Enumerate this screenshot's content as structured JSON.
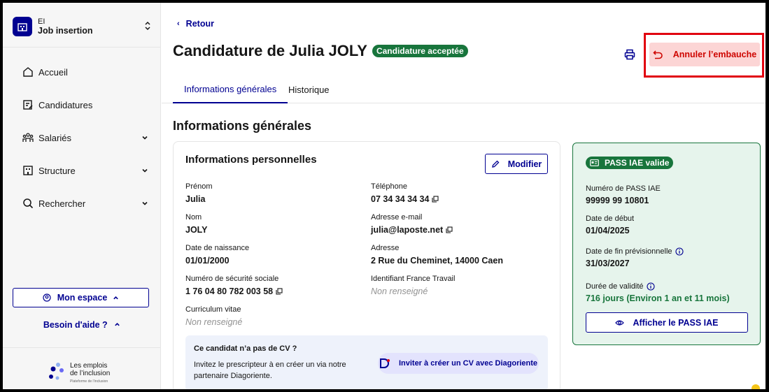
{
  "sidebar": {
    "org_kind": "EI",
    "org_name": "Job insertion",
    "nav": [
      {
        "label": "Accueil",
        "icon": "home-icon"
      },
      {
        "label": "Candidatures",
        "icon": "edit-list-icon"
      },
      {
        "label": "Salariés",
        "icon": "people-icon"
      },
      {
        "label": "Structure",
        "icon": "building-icon"
      },
      {
        "label": "Rechercher",
        "icon": "search-icon"
      }
    ],
    "mon_espace": "Mon espace",
    "help": "Besoin d'aide ?",
    "brand_line1": "Les emplois",
    "brand_line2": "de l’inclusion",
    "brand_sub": "Plateforme de l’inclusion"
  },
  "header": {
    "back": "Retour",
    "title": "Candidature de Julia JOLY",
    "status_badge": "Candidature acceptée",
    "cancel_button": "Annuler l’embauche"
  },
  "tabs": [
    {
      "label": "Informations générales",
      "active": true
    },
    {
      "label": "Historique",
      "active": false
    }
  ],
  "section_title": "Informations générales",
  "personal": {
    "title": "Informations personnelles",
    "edit_button": "Modifier",
    "fields": {
      "prenom": {
        "label": "Prénom",
        "value": "Julia"
      },
      "telephone": {
        "label": "Téléphone",
        "value": "07 34 34 34 34"
      },
      "nom": {
        "label": "Nom",
        "value": "JOLY"
      },
      "email": {
        "label": "Adresse e-mail",
        "value": "julia@laposte.net"
      },
      "naissance": {
        "label": "Date de naissance",
        "value": "01/01/2000"
      },
      "adresse": {
        "label": "Adresse",
        "value": "2 Rue du Cheminet, 14000 Caen"
      },
      "secu": {
        "label": "Numéro de sécurité sociale",
        "value": "1 76 04 80 782 003 58"
      },
      "ft": {
        "label": "Identifiant France Travail",
        "value": "Non renseigné"
      },
      "cv": {
        "label": "Curriculum vitae",
        "value": "Non renseigné"
      }
    },
    "nocv": {
      "title": "Ce candidat n’a pas de CV ?",
      "text": "Invitez le prescripteur à en créer un via notre partenaire Diagoriente.",
      "button": "Inviter à créer un CV avec Diagoriente"
    }
  },
  "pass": {
    "badge": "PASS IAE valide",
    "numero_label": "Numéro de PASS IAE",
    "numero": "99999 99 10801",
    "debut_label": "Date de début",
    "debut": "01/04/2025",
    "fin_label": "Date de fin prévisionnelle",
    "fin": "31/03/2027",
    "duree_label": "Durée de validité",
    "duree": "716 jours (Environ 1 an et 11 mois)",
    "button": "Afficher le PASS IAE"
  },
  "colors": {
    "primary": "#000091",
    "success": "#18753c",
    "danger": "#ce0500",
    "highlight": "#e1000f"
  }
}
